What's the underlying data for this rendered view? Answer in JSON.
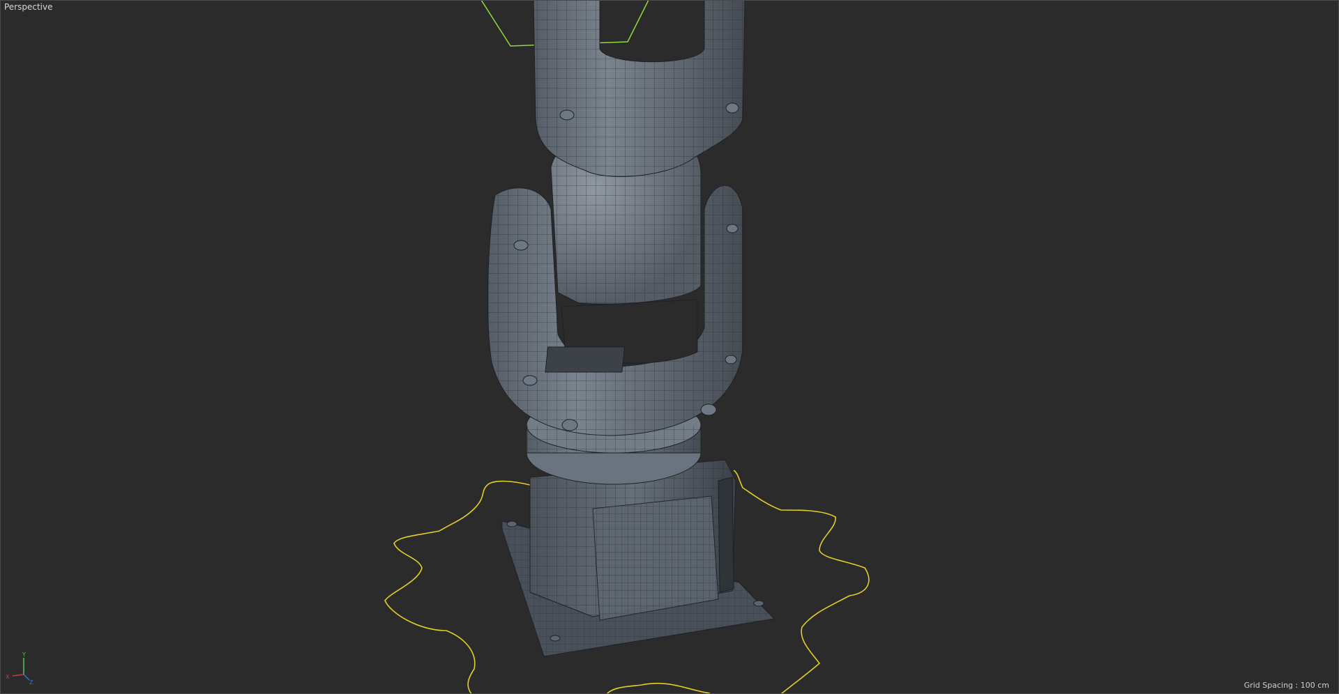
{
  "viewport": {
    "camera_label": "Perspective",
    "grid_spacing": "Grid Spacing : 100 cm"
  },
  "axis_gizmo": {
    "y_label": "Y",
    "x_label": "X",
    "z_label": "Z",
    "y_color": "#59c94c",
    "x_color": "#d23a3a",
    "z_color": "#3f6ed8"
  },
  "scene": {
    "object": "robot-arm-mesh",
    "selection_spline_color": "#e3cf26",
    "arm_spline_color": "#8fdc3a",
    "mesh_color": "#5b6470"
  }
}
